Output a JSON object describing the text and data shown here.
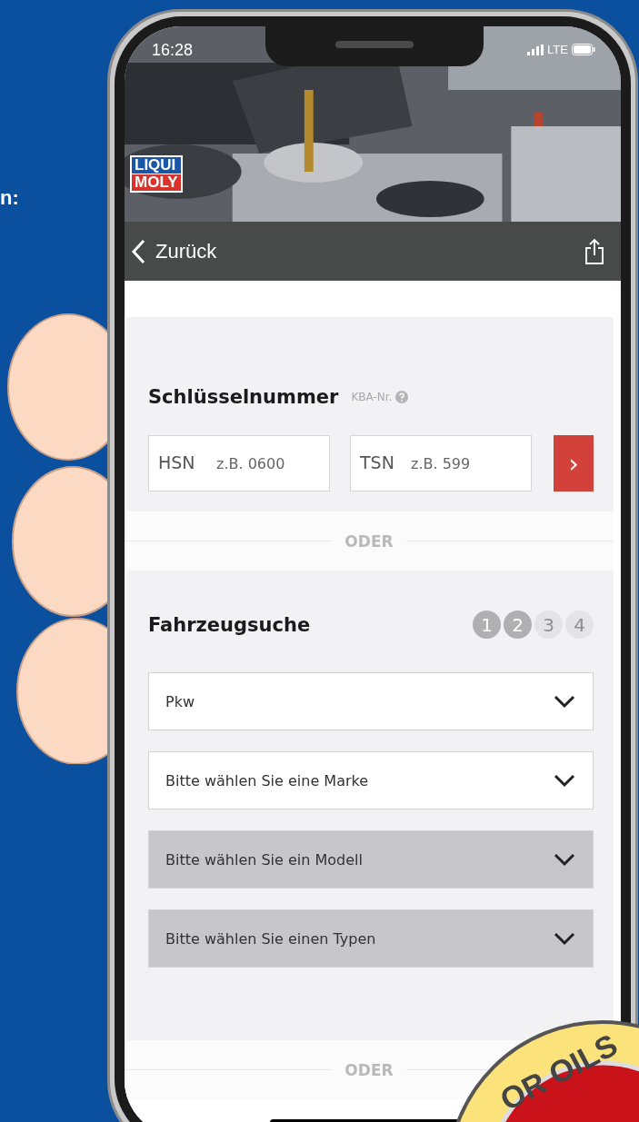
{
  "side_text": "n:",
  "status_bar": {
    "time": "16:28",
    "network": "LTE"
  },
  "header": {
    "logo": [
      "LIQUI",
      "MOLY"
    ]
  },
  "nav": {
    "back": "Zurück"
  },
  "key_number": {
    "title": "Schlüsselnummer",
    "hint": "KBA-Nr.",
    "fields": [
      {
        "label": "HSN",
        "placeholder": "z.B. 0600"
      },
      {
        "label": "TSN",
        "placeholder": "z.B. 599"
      }
    ],
    "submit": "›"
  },
  "divider_1": "ODER",
  "vehicle_search": {
    "title": "Fahrzeugsuche",
    "steps": [
      {
        "label": "1",
        "active": true
      },
      {
        "label": "2",
        "active": true
      },
      {
        "label": "3",
        "active": false
      },
      {
        "label": "4",
        "active": false
      }
    ],
    "selects": [
      {
        "value": "Pkw",
        "disabled": false
      },
      {
        "value": "Bitte wählen Sie eine Marke",
        "disabled": false
      },
      {
        "value": "Bitte wählen Sie ein Modell",
        "disabled": true
      },
      {
        "value": "Bitte wählen Sie einen Typen",
        "disabled": true
      }
    ]
  },
  "divider_2": "ODER",
  "badge": "OR OILS"
}
